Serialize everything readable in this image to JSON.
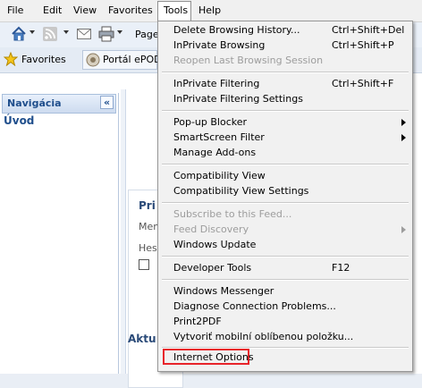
{
  "menubar": {
    "items": [
      "File",
      "Edit",
      "View",
      "Favorites",
      "Tools",
      "Help"
    ]
  },
  "toolbar": {
    "page_label": "Page"
  },
  "favorites_bar": {
    "favorites_label": "Favorites",
    "tab_label": "Portál ePOD"
  },
  "nav_pane": {
    "header": "Navigácia",
    "collapse_glyph": "«",
    "item": "Úvod"
  },
  "page": {
    "login_title": "Pri",
    "field1": "Men",
    "field2": "Hes",
    "news_title": "Aktu"
  },
  "tools_menu": {
    "items": [
      {
        "label": "Delete Browsing History...",
        "shortcut": "Ctrl+Shift+Del"
      },
      {
        "label": "InPrivate Browsing",
        "shortcut": "Ctrl+Shift+P"
      },
      {
        "label": "Reopen Last Browsing Session",
        "disabled": true
      },
      {
        "label": "InPrivate Filtering",
        "shortcut": "Ctrl+Shift+F"
      },
      {
        "label": "InPrivate Filtering Settings"
      },
      {
        "label": "Pop-up Blocker",
        "submenu": true
      },
      {
        "label": "SmartScreen Filter",
        "submenu": true
      },
      {
        "label": "Manage Add-ons"
      },
      {
        "label": "Compatibility View"
      },
      {
        "label": "Compatibility View Settings"
      },
      {
        "label": "Subscribe to this Feed...",
        "disabled": true
      },
      {
        "label": "Feed Discovery",
        "disabled": true,
        "submenu": true
      },
      {
        "label": "Windows Update"
      },
      {
        "label": "Developer Tools",
        "shortcut": "F12"
      },
      {
        "label": "Windows Messenger"
      },
      {
        "label": "Diagnose Connection Problems..."
      },
      {
        "label": "Print2PDF"
      },
      {
        "label": "Vytvoriť mobilní oblíbenou položku..."
      },
      {
        "label": "Internet Options",
        "highlighted": true
      }
    ]
  },
  "colors": {
    "highlight_border": "#e8232a",
    "nav_header_text": "#1f4e8c"
  }
}
